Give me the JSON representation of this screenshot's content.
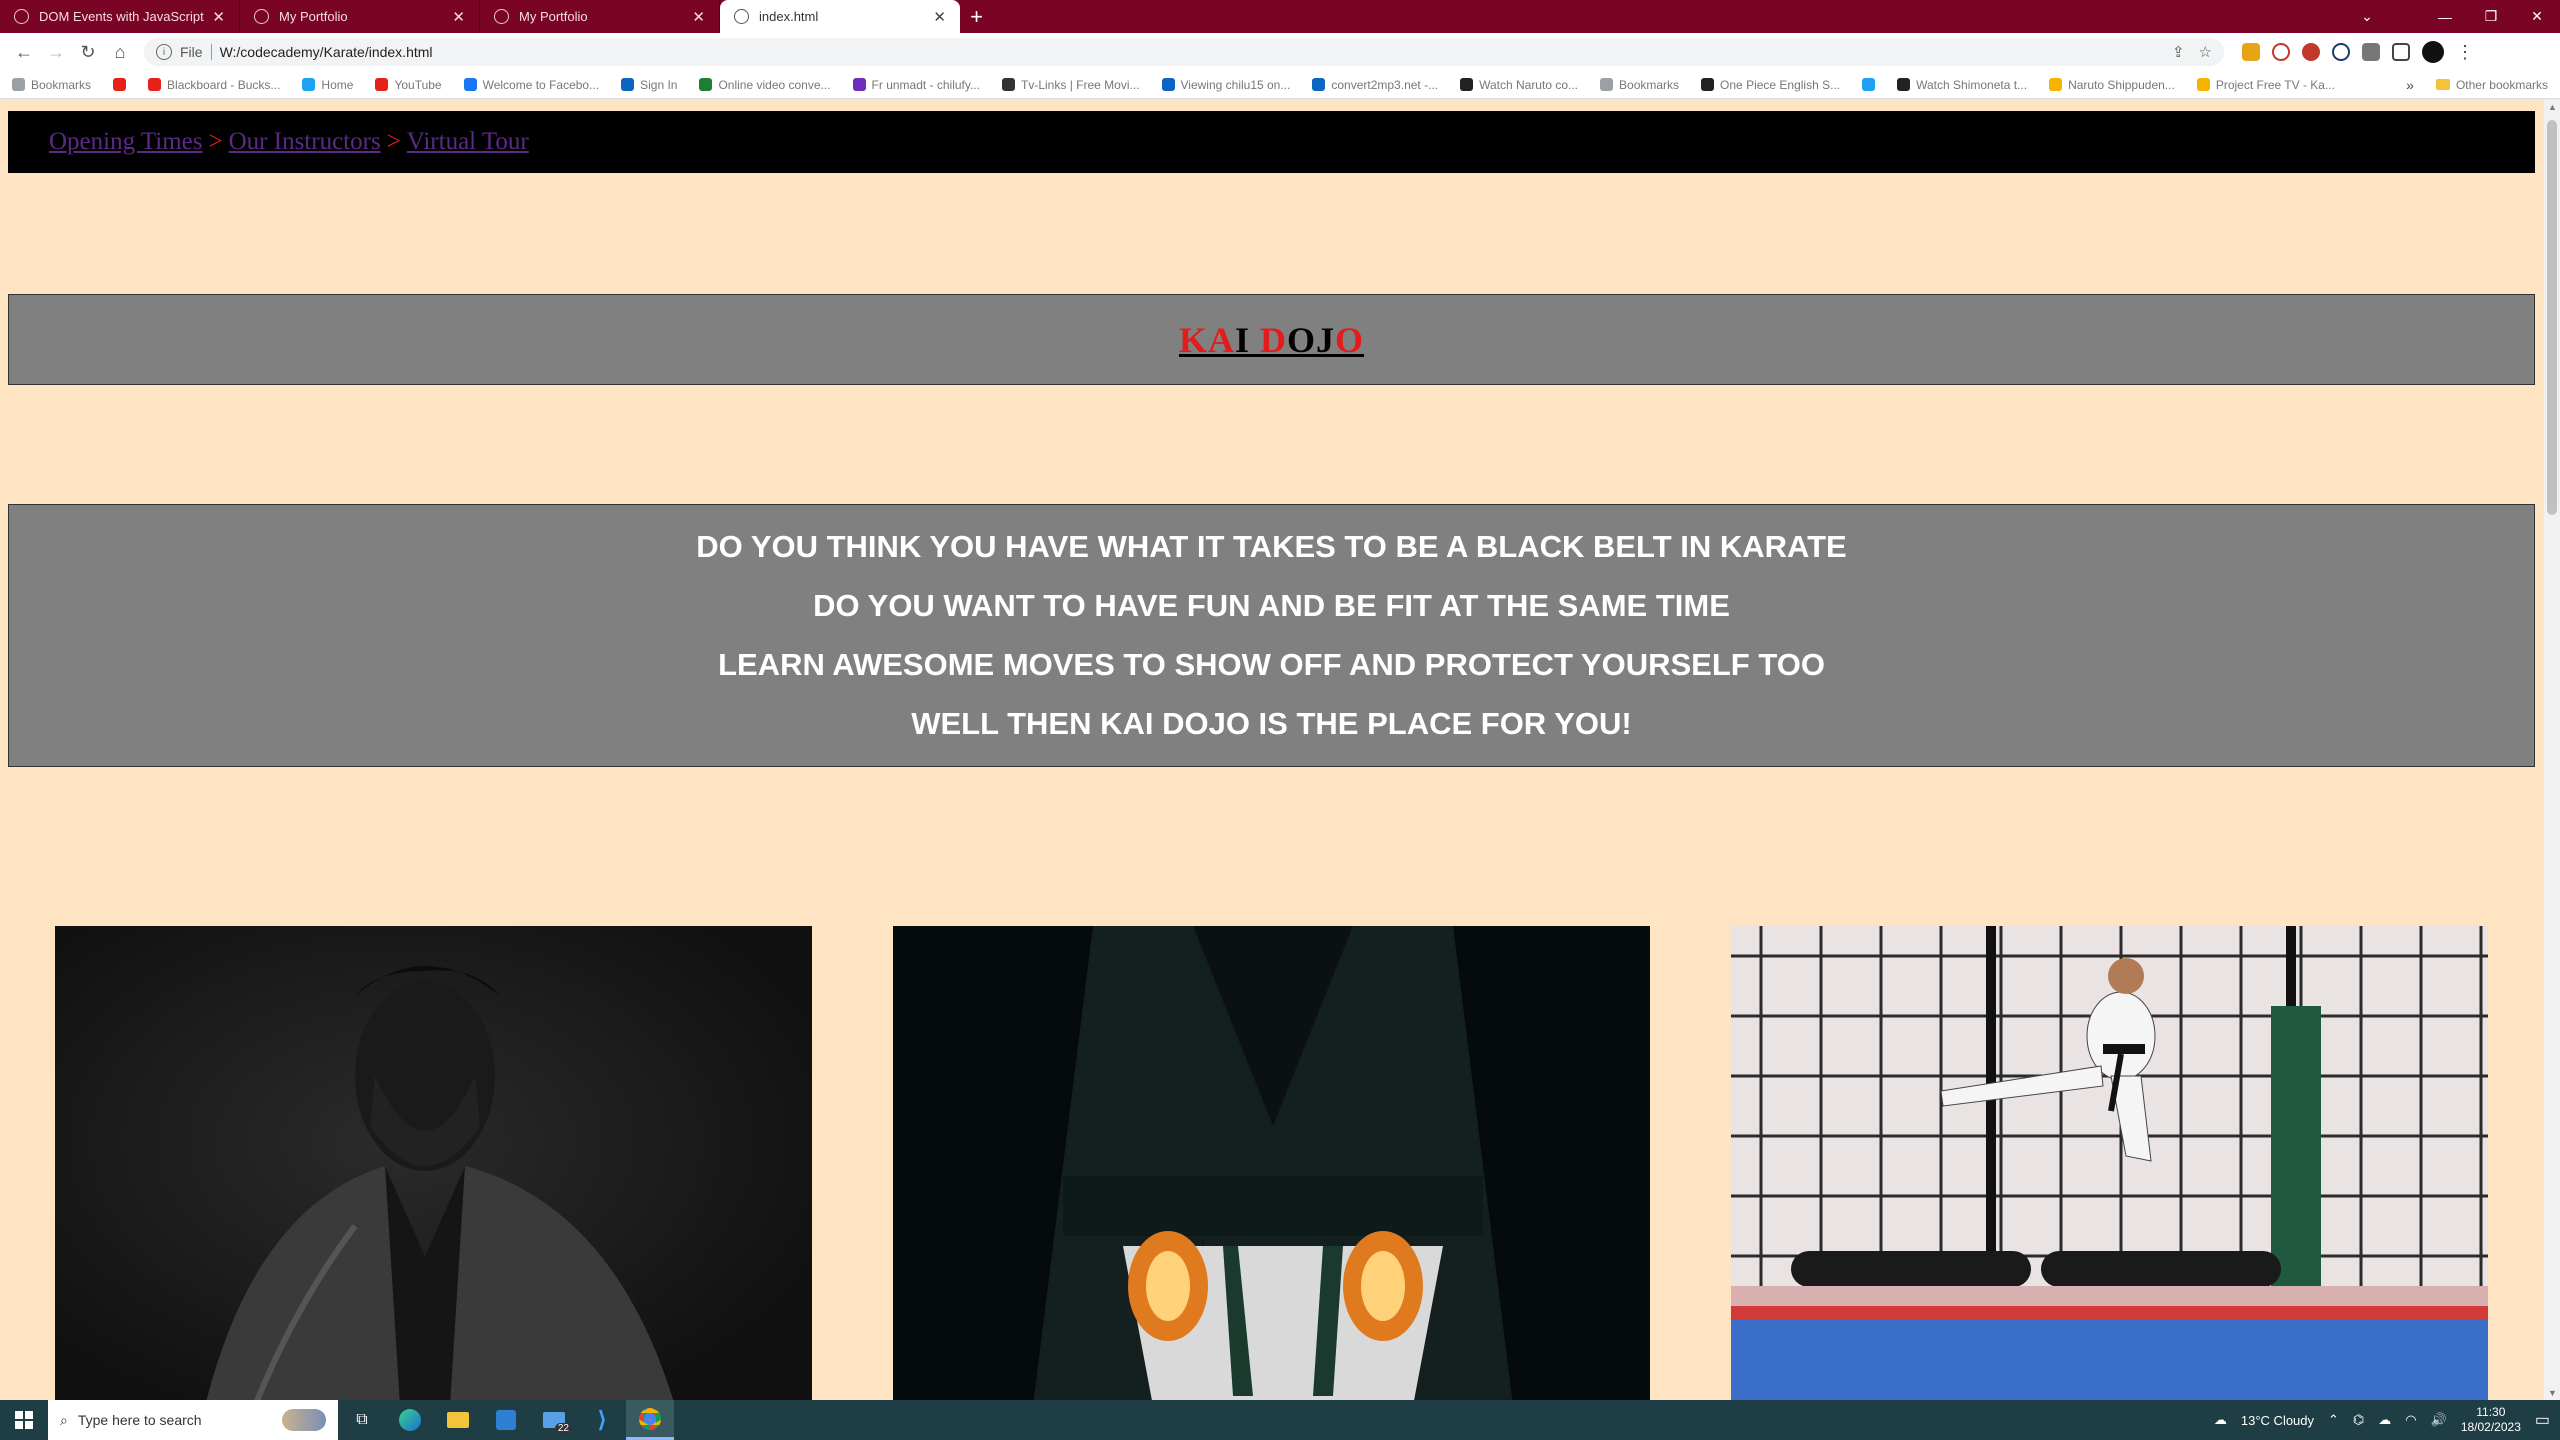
{
  "browser": {
    "tabs": [
      {
        "label": "DOM Events with JavaScript | Co",
        "active": false,
        "favicon": "codecademy-icon"
      },
      {
        "label": "My Portfolio",
        "active": false,
        "favicon": "globe-icon"
      },
      {
        "label": "My Portfolio",
        "active": false,
        "favicon": "globe-icon"
      },
      {
        "label": "index.html",
        "active": true,
        "favicon": "globe-icon"
      }
    ],
    "address": {
      "scheme": "File",
      "url": "W:/codecademy/Karate/index.html"
    },
    "bookmarks": [
      {
        "label": "Bookmarks",
        "color": "#9aa0a6"
      },
      {
        "label": "",
        "color": "#e62117"
      },
      {
        "label": "Blackboard - Bucks...",
        "color": "#e62117"
      },
      {
        "label": "Home",
        "color": "#1da1f2"
      },
      {
        "label": "YouTube",
        "color": "#e62117"
      },
      {
        "label": "Welcome to Facebo...",
        "color": "#1877f2"
      },
      {
        "label": "Sign In",
        "color": "#0a66c2"
      },
      {
        "label": "Online video conve...",
        "color": "#1e7e34"
      },
      {
        "label": "Fr unmadt - chilufy...",
        "color": "#6f2dbd"
      },
      {
        "label": "Tv-Links | Free Movi...",
        "color": "#333333"
      },
      {
        "label": "Viewing chilu15 on...",
        "color": "#0a66c2"
      },
      {
        "label": "convert2mp3.net -...",
        "color": "#0a66c2"
      },
      {
        "label": "Watch Naruto co...",
        "color": "#222222"
      },
      {
        "label": "Bookmarks",
        "color": "#9aa0a6"
      },
      {
        "label": "One Piece English S...",
        "color": "#222222"
      },
      {
        "label": "",
        "color": "#1da1f2"
      },
      {
        "label": "Watch Shimoneta t...",
        "color": "#222222"
      },
      {
        "label": "Naruto Shippuden...",
        "color": "#f4b400"
      },
      {
        "label": "Project Free TV - Ka...",
        "color": "#f4b400"
      }
    ],
    "other_bookmarks": "Other bookmarks"
  },
  "site": {
    "nav": [
      {
        "label": "Opening Times"
      },
      {
        "label": "Our Instructors"
      },
      {
        "label": "Virtual Tour"
      }
    ],
    "nav_separator": ">",
    "title_letters": [
      {
        "ch": "K",
        "color": "red"
      },
      {
        "ch": "A",
        "color": "red"
      },
      {
        "ch": "I",
        "color": "blk"
      },
      {
        "ch": " ",
        "color": "blk"
      },
      {
        "ch": "D",
        "color": "red"
      },
      {
        "ch": "O",
        "color": "blk"
      },
      {
        "ch": "J",
        "color": "blk"
      },
      {
        "ch": "O",
        "color": "red"
      }
    ],
    "taglines": [
      "DO YOU THINK YOU HAVE WHAT IT TAKES TO BE A BLACK BELT IN KARATE",
      "DO YOU WANT TO HAVE FUN AND BE FIT AT THE SAME TIME",
      "LEARN AWESOME MOVES TO SHOW OFF AND PROTECT YOURSELF TOO",
      "WELL THEN KAI DOJO IS THE PLACE FOR YOU!"
    ],
    "photos": [
      {
        "name": "photo-karateka-bowing"
      },
      {
        "name": "photo-black-belt-gi"
      },
      {
        "name": "photo-flying-kick"
      }
    ],
    "colors": {
      "page_bg": "#ffe4c4",
      "nav_bg": "#000000",
      "box_bg": "#808080",
      "accent_red": "#e31b1b",
      "link": "#5b2a86"
    }
  },
  "taskbar": {
    "search_placeholder": "Type here to search",
    "mail_badge": "22",
    "weather": "13°C  Cloudy",
    "time": "11:30",
    "date": "18/02/2023"
  }
}
